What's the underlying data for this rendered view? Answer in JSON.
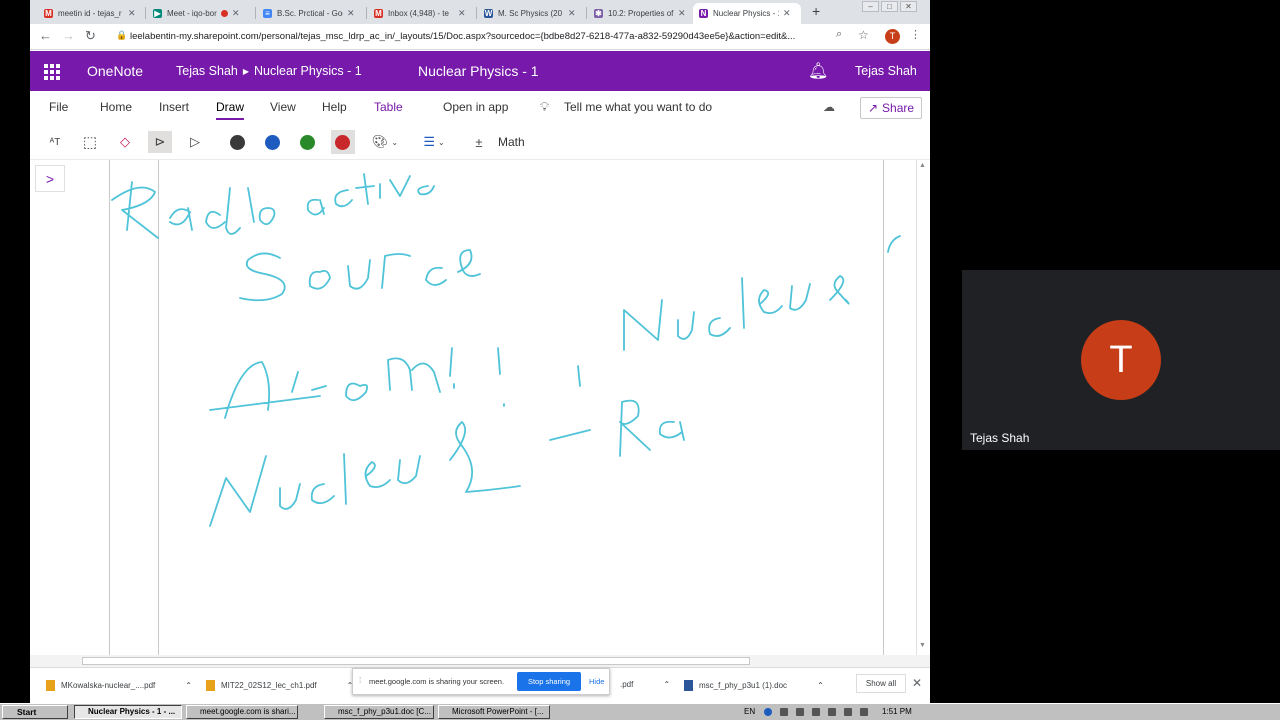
{
  "browser": {
    "tabs": [
      {
        "title": "meetin id - tejas_r",
        "favicon": "gmail-icon",
        "color": "#d93025"
      },
      {
        "title": "Meet - iqo-bor",
        "favicon": "meet-icon",
        "color": "#00897b"
      },
      {
        "title": "B.Sc. Prctical - Goo",
        "favicon": "docs-icon",
        "color": "#4285f4"
      },
      {
        "title": "Inbox (4,948) - te",
        "favicon": "gmail-icon",
        "color": "#d93025"
      },
      {
        "title": "M. Sc Physics (20",
        "favicon": "word-icon",
        "color": "#2b579a"
      },
      {
        "title": "10.2: Properties of",
        "favicon": "libretexts-icon",
        "color": "#7b5ea7"
      },
      {
        "title": "Nuclear Physics - 1",
        "favicon": "onenote-icon",
        "color": "#7719aa"
      }
    ],
    "url": "leelabentin-my.sharepoint.com/personal/tejas_msc_ldrp_ac_in/_layouts/15/Doc.aspx?sourcedoc={bdbe8d27-6218-477a-a832-59290d43ee5e}&action=edit&...",
    "profile_initial": "T"
  },
  "onenote": {
    "app_name": "OneNote",
    "breadcrumb_user": "Tejas Shah",
    "breadcrumb_notebook": "Nuclear Physics - 1",
    "doc_title": "Nuclear Physics - 1",
    "user_name": "Tejas Shah",
    "ribbon_tabs": [
      "File",
      "Home",
      "Insert",
      "Draw",
      "View",
      "Help",
      "Table"
    ],
    "active_tab": "Draw",
    "open_in_app": "Open in app",
    "tell_me": "Tell me what you want to do",
    "share": "Share",
    "math": "Math",
    "pen_colors": [
      "#3a3a3a",
      "#1e5bbf",
      "#2a8a2a",
      "#c8282b"
    ],
    "ink_color": "#4fc3d8"
  },
  "downloads": [
    {
      "name": "MKowalska-nuclear_....pdf"
    },
    {
      "name": "MIT22_02S12_lec_ch1.pdf"
    },
    {
      "name": ".pdf"
    },
    {
      "name": "msc_f_phy_p3u1 (1).doc"
    }
  ],
  "sharing": {
    "message": "meet.google.com is sharing your screen.",
    "stop": "Stop sharing",
    "hide": "Hide"
  },
  "shelf": {
    "show_all": "Show all"
  },
  "meet": {
    "avatar_initial": "T",
    "participant": "Tejas Shah",
    "avatar_color": "#c63d17"
  },
  "taskbar": {
    "start": "Start",
    "tasks": [
      "Nuclear Physics - 1 - ...",
      "meet.google.com is shari...",
      "msc_f_phy_p3u1.doc [C...",
      "Microsoft PowerPoint - [..."
    ],
    "lang": "EN",
    "clock": "1:51 PM"
  }
}
